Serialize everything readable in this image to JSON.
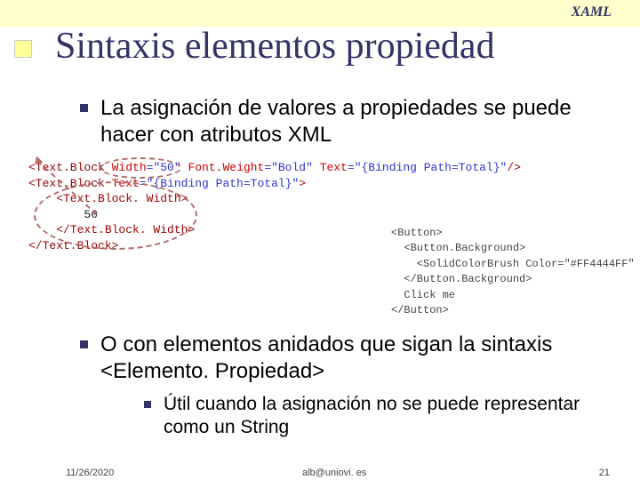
{
  "header": {
    "label": "XAML"
  },
  "title": "Sintaxis elementos propiedad",
  "bullets": {
    "b1": "La asignación de valores a propiedades se puede hacer con atributos XML",
    "b2": "O con elementos anidados que sigan la sintaxis <Elemento. Propiedad>",
    "b3": "Útil cuando la asignación no se puede representar como un String"
  },
  "code1": {
    "l1_tag": "<Text.Block",
    "l1_a1": " Width",
    "l1_v1": "=\"50\"",
    "l1_a2": " Font.Weight",
    "l1_v2": "=\"Bold\"",
    "l1_a3": " Text",
    "l1_v3": "=\"{Binding Path=Total}\"",
    "l1_end": "/>",
    "l2_tag": "<Text.Block",
    "l2_a1": " Text",
    "l2_v1": "=\"{Binding Path=Total}\"",
    "l2_end": ">",
    "l3": "    <Text.Block. Width>",
    "l4": "        50",
    "l5": "    </Text.Block. Width>",
    "l6": "</Text.Block>"
  },
  "code2": {
    "l1": "<Button>",
    "l2": "  <Button.Background>",
    "l3a": "    <SolidColorBrush",
    "l3b": " Color",
    "l3c": "=\"#FF4444FF\"",
    "l3d": " />",
    "l4": "  </Button.Background>",
    "l5": "  Click me",
    "l6": "</Button>"
  },
  "footer": {
    "date": "11/26/2020",
    "email": "alb@uniovi. es",
    "page": "21"
  }
}
